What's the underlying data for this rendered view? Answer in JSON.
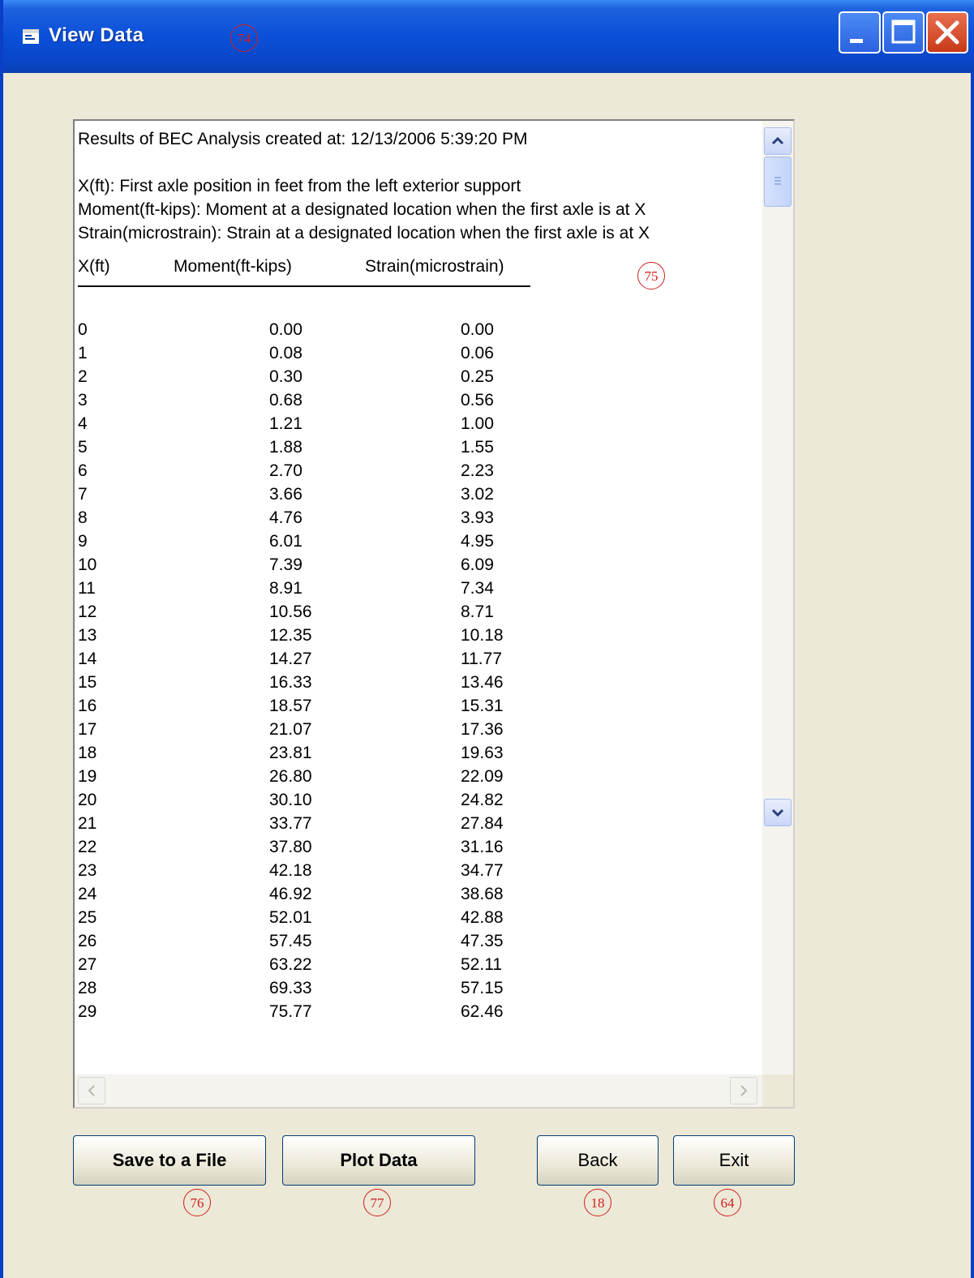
{
  "window": {
    "title": "View Data",
    "annotation": "74"
  },
  "textbox": {
    "annotation": "75",
    "header_line": "Results of BEC Analysis created at: 12/13/2006 5:39:20 PM",
    "desc_lines": [
      "X(ft): First axle position in feet from the left exterior support",
      "Moment(ft-kips): Moment at a designated location when the first axle is at X",
      "Strain(microstrain): Strain at a designated location when the first axle is at X"
    ],
    "columns": [
      "X(ft)",
      "Moment(ft-kips)",
      "Strain(microstrain)"
    ],
    "rows": [
      [
        "0",
        "0.00",
        "0.00"
      ],
      [
        "1",
        "0.08",
        "0.06"
      ],
      [
        "2",
        "0.30",
        "0.25"
      ],
      [
        "3",
        "0.68",
        "0.56"
      ],
      [
        "4",
        "1.21",
        "1.00"
      ],
      [
        "5",
        "1.88",
        "1.55"
      ],
      [
        "6",
        "2.70",
        "2.23"
      ],
      [
        "7",
        "3.66",
        "3.02"
      ],
      [
        "8",
        "4.76",
        "3.93"
      ],
      [
        "9",
        "6.01",
        "4.95"
      ],
      [
        "10",
        "7.39",
        "6.09"
      ],
      [
        "11",
        "8.91",
        "7.34"
      ],
      [
        "12",
        "10.56",
        "8.71"
      ],
      [
        "13",
        "12.35",
        "10.18"
      ],
      [
        "14",
        "14.27",
        "11.77"
      ],
      [
        "15",
        "16.33",
        "13.46"
      ],
      [
        "16",
        "18.57",
        "15.31"
      ],
      [
        "17",
        "21.07",
        "17.36"
      ],
      [
        "18",
        "23.81",
        "19.63"
      ],
      [
        "19",
        "26.80",
        "22.09"
      ],
      [
        "20",
        "30.10",
        "24.82"
      ],
      [
        "21",
        "33.77",
        "27.84"
      ],
      [
        "22",
        "37.80",
        "31.16"
      ],
      [
        "23",
        "42.18",
        "34.77"
      ],
      [
        "24",
        "46.92",
        "38.68"
      ],
      [
        "25",
        "52.01",
        "42.88"
      ],
      [
        "26",
        "57.45",
        "47.35"
      ],
      [
        "27",
        "63.22",
        "52.11"
      ],
      [
        "28",
        "69.33",
        "57.15"
      ],
      [
        "29",
        "75.77",
        "62.46"
      ]
    ]
  },
  "buttons": {
    "save": {
      "label": "Save to a File",
      "annotation": "76"
    },
    "plot": {
      "label": "Plot Data",
      "annotation": "77"
    },
    "back": {
      "label": "Back",
      "annotation": "18"
    },
    "exit": {
      "label": "Exit",
      "annotation": "64"
    }
  },
  "icons": {
    "app": "window-icon",
    "minimize": "minimize-icon",
    "maximize": "maximize-icon",
    "close": "close-icon",
    "scroll_up": "chevron-up-icon",
    "scroll_down": "chevron-down-icon",
    "scroll_left": "chevron-left-icon",
    "scroll_right": "chevron-right-icon"
  },
  "colors": {
    "titlebar": "#0a4fd8",
    "close_button": "#c83a18",
    "annotation": "#d0201c",
    "window_bg": "#ece9d8"
  }
}
